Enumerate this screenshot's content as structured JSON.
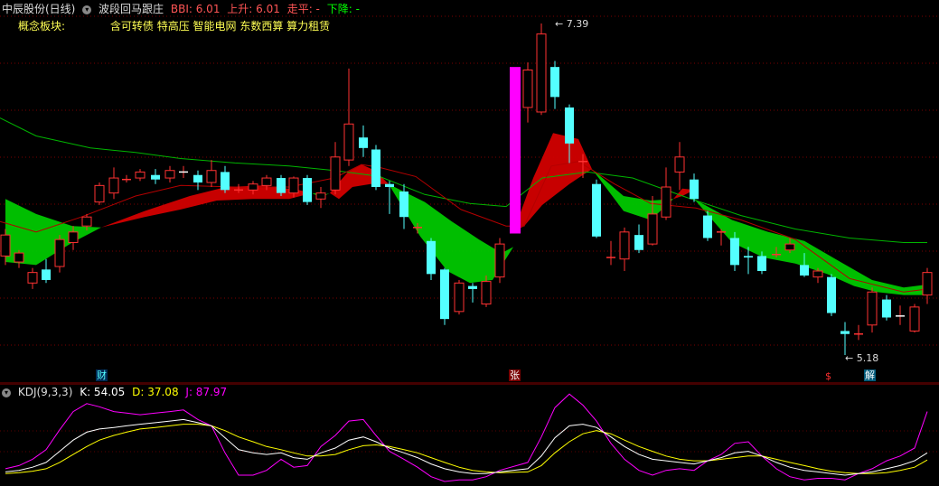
{
  "header": {
    "stock": "中辰股份(日线)",
    "indicator_name": "波段回马跟庄",
    "bbi_label": "BBI: 6.01",
    "up_label": "上升: 6.01",
    "flat_label": "走平: -",
    "down_label": "下降: -"
  },
  "concept": {
    "label": "概念板块:",
    "items": "含可转债 特高压 智能电网 东数西算 算力租赁"
  },
  "price_labels": {
    "high": "7.39",
    "low": "5.18"
  },
  "markers": {
    "cai": "财",
    "zhang": "张",
    "dollar": "$",
    "jie": "解"
  },
  "kdj": {
    "name": "KDJ(9,3,3)",
    "k_label": "K: 54.05",
    "d_label": "D: 37.08",
    "j_label": "J: 87.97"
  },
  "colors": {
    "bg": "#000000",
    "up": "#ff3232",
    "down": "#54ffff",
    "magenta": "#ff00ff",
    "green_band": "#00c800",
    "red_band": "#d20000",
    "ma_green": "#00b400",
    "ma_red": "#b40000",
    "k_line": "#ffffff",
    "d_line": "#ffff00",
    "j_line": "#ff00ff",
    "header_name": "#ff5555",
    "header_up": "#ff5555",
    "header_down": "#00ff00",
    "concept": "#ffff54"
  },
  "icons": [
    "chevron-circle-icon",
    "chevron-circle-icon"
  ]
}
